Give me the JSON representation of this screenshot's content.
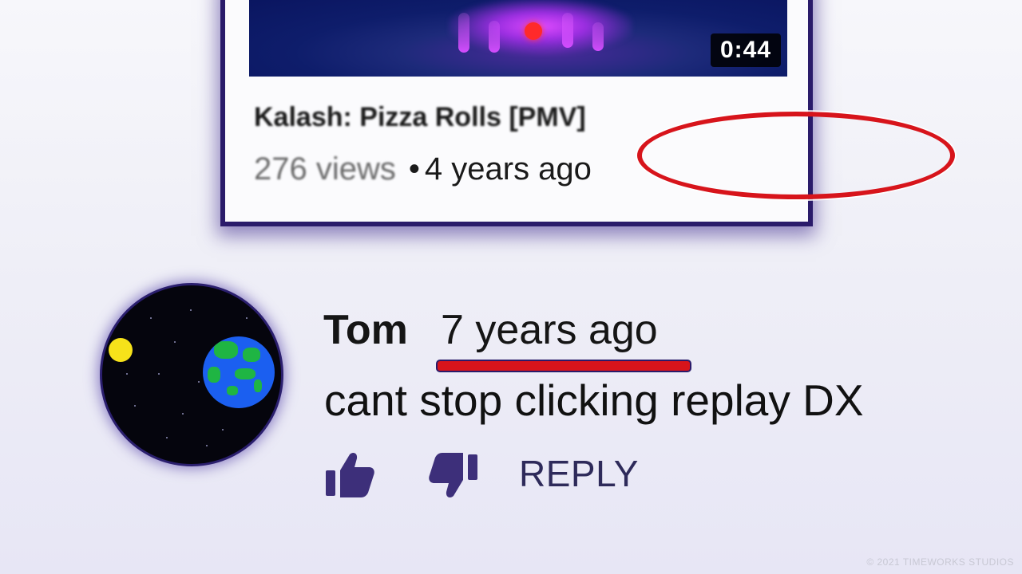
{
  "video": {
    "duration": "0:44",
    "title": "Kalash: Pizza Rolls [PMV]",
    "views": "276 views",
    "separator": "•",
    "age": "4 years ago"
  },
  "comment": {
    "author": "Tom",
    "timestamp": "7 years ago",
    "text": "cant stop clicking replay DX",
    "reply_label": "REPLY",
    "like_icon": "thumbs-up-icon",
    "dislike_icon": "thumbs-down-icon"
  },
  "annotations": {
    "highlight_color": "#d7141b"
  },
  "watermark": "© 2021 TIMEWORKS STUDIOS",
  "colors": {
    "action_icon": "#3d2f7a",
    "card_border": "#2a1b6a"
  }
}
